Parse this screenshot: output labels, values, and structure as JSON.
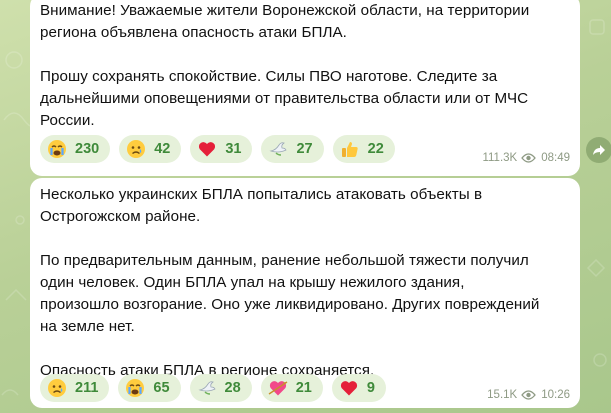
{
  "messages": [
    {
      "text": "Внимание! Уважаемые жители Воронежской области, на территории\nрегиона объявлена опасность атаки БПЛА.\n\nПрошу сохранять спокойствие. Силы ПВО наготове. Следите за\nдальнейшими оповещениями от правительства области или от МЧС\nРоссии.",
      "reactions": [
        {
          "icon": "crying-face-icon",
          "count": "230"
        },
        {
          "icon": "sad-face-icon",
          "count": "42"
        },
        {
          "icon": "red-heart-icon",
          "count": "31"
        },
        {
          "icon": "dove-icon",
          "count": "27"
        },
        {
          "icon": "thumbs-up-icon",
          "count": "22"
        }
      ],
      "views": "111.3K",
      "time": "08:49"
    },
    {
      "text": "Несколько украинских БПЛА попытались атаковать объекты в\nОстрогожском районе.\n\nПо предварительным данным, ранение небольшой тяжести получил\nодин человек. Один БПЛА упал на крышу нежилого здания,\nпроизошло возгорание. Оно уже ликвидировано. Других повреждений\nна земле нет.\n\nОпасность атаки БПЛА в регионе сохраняется.",
      "reactions": [
        {
          "icon": "sad-face-icon",
          "count": "211"
        },
        {
          "icon": "crying-face-icon",
          "count": "65"
        },
        {
          "icon": "dove-icon",
          "count": "28"
        },
        {
          "icon": "heart-with-arrow-icon",
          "count": "21"
        },
        {
          "icon": "red-heart-icon",
          "count": "9"
        }
      ],
      "views": "15.1K",
      "time": "10:26"
    }
  ],
  "colors": {
    "reaction_count": "#3f8a3a",
    "reaction_bg": "#e6f1da",
    "meta_text": "#8e9a84",
    "chat_background": "#c6d8a4"
  },
  "share_button_icon": "forward-arrow-icon",
  "view_icon": "eye-icon"
}
